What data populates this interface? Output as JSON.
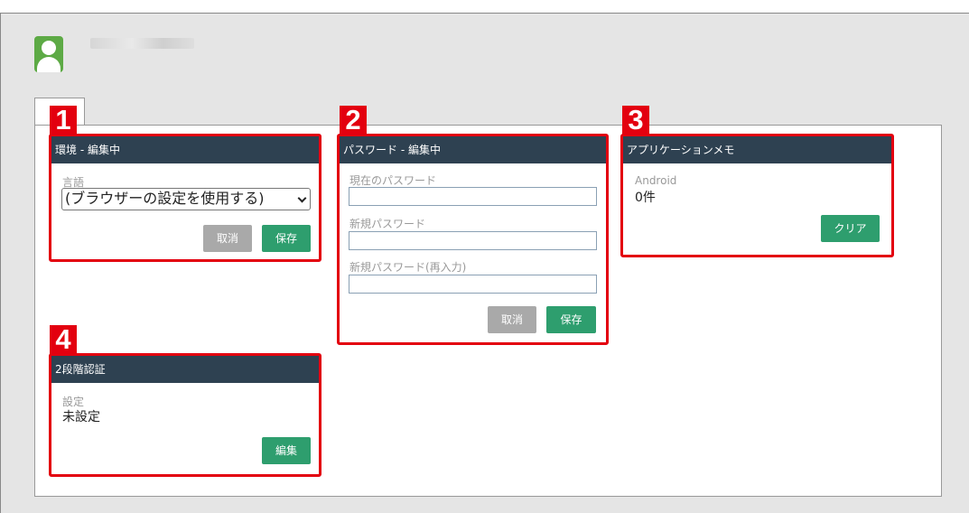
{
  "cards": {
    "environment": {
      "number": "1",
      "title": "環境 - 編集中",
      "language_label": "言語",
      "language_value": "(ブラウザーの設定を使用する)",
      "cancel_label": "取消",
      "save_label": "保存"
    },
    "password": {
      "number": "2",
      "title": "パスワード - 編集中",
      "current_label": "現在のパスワード",
      "new_label": "新規パスワード",
      "confirm_label": "新規パスワード(再入力)",
      "current_value": "",
      "new_value": "",
      "confirm_value": "",
      "cancel_label": "取消",
      "save_label": "保存"
    },
    "app_memo": {
      "number": "3",
      "title": "アプリケーションメモ",
      "platform_label": "Android",
      "count_value": "0件",
      "clear_label": "クリア"
    },
    "two_factor": {
      "number": "4",
      "title": "2段階認証",
      "setting_label": "設定",
      "setting_value": "未設定",
      "edit_label": "編集"
    }
  },
  "colors": {
    "highlight": "#e3000f",
    "header": "#2e4151",
    "primary_button": "#2e9e6e",
    "secondary_button": "#a9a9a9",
    "avatar": "#5daa45"
  },
  "icons": {
    "avatar": "user-avatar-icon",
    "dropdown": "chevron-down-icon"
  }
}
